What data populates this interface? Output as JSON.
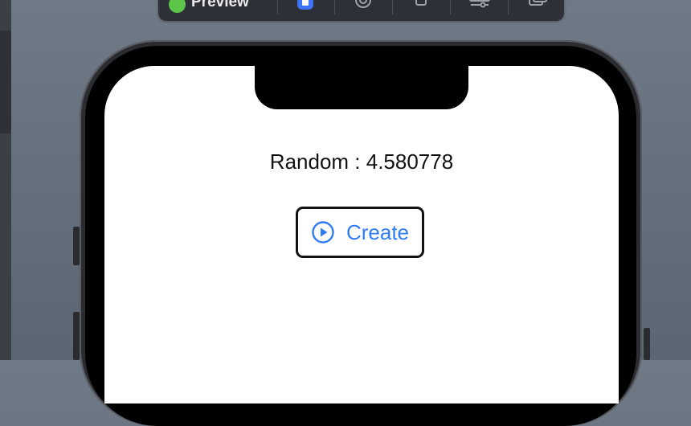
{
  "toolbar": {
    "title": "Preview",
    "status_color": "#5cc54a",
    "buttons": [
      {
        "icon": "live-preview-icon",
        "active": true
      },
      {
        "icon": "selectable-icon"
      },
      {
        "icon": "device-icon"
      },
      {
        "icon": "settings-sliders-icon"
      },
      {
        "icon": "duplicate-icon"
      }
    ]
  },
  "app": {
    "random_text": "Random : 4.580778",
    "create_label": "Create",
    "create_icon": "play-circle-icon",
    "accent_color": "#2f7cf6"
  }
}
